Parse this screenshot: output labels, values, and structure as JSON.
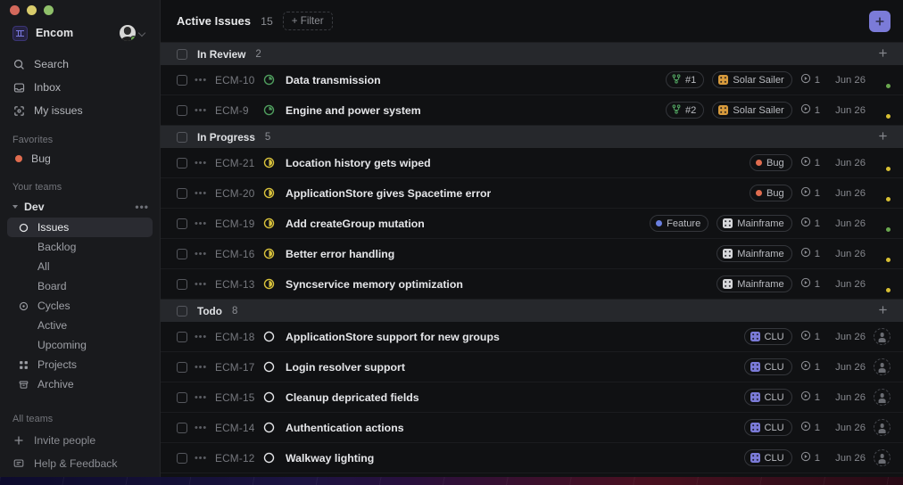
{
  "window": {
    "traffic_lights": [
      "close",
      "minimize",
      "maximize"
    ]
  },
  "sidebar": {
    "workspace": {
      "name": "Encom",
      "logo": "encom-logo",
      "chevron": "chevron-down-icon"
    },
    "nav": [
      {
        "label": "Search",
        "icon": "search-icon"
      },
      {
        "label": "Inbox",
        "icon": "inbox-icon"
      },
      {
        "label": "My issues",
        "icon": "my-issues-icon"
      }
    ],
    "favorites": {
      "label": "Favorites",
      "items": [
        {
          "label": "Bug",
          "color": "#e06c4f"
        }
      ]
    },
    "your_teams": {
      "label": "Your teams",
      "team": {
        "name": "Dev",
        "menu": "•••"
      },
      "items": [
        {
          "label": "Issues",
          "icon": "circle-icon",
          "active": true
        },
        {
          "label": "Backlog",
          "icon": ""
        },
        {
          "label": "All",
          "icon": ""
        },
        {
          "label": "Board",
          "icon": ""
        },
        {
          "label": "Cycles",
          "icon": "cycle-icon"
        },
        {
          "label": "Active",
          "icon": ""
        },
        {
          "label": "Upcoming",
          "icon": ""
        },
        {
          "label": "Projects",
          "icon": "projects-icon"
        },
        {
          "label": "Archive",
          "icon": "archive-icon"
        }
      ]
    },
    "all_teams_label": "All teams",
    "footer": [
      {
        "label": "Invite people",
        "icon": "plus-icon"
      },
      {
        "label": "Help & Feedback",
        "icon": "help-icon"
      }
    ]
  },
  "topbar": {
    "title": "Active Issues",
    "count": "15",
    "filter_label": "+ Filter",
    "new_issue_icon": "plus-icon",
    "accent_color": "#7b7bd8"
  },
  "groups": [
    {
      "name": "In Review",
      "count": "2",
      "status_icon": "in-review-icon",
      "status_color": "#4f9e5e",
      "add_icon": "plus-icon",
      "rows": [
        {
          "id": "ECM-10",
          "title": "Data transmission",
          "branch": "#1",
          "label": null,
          "label_color": null,
          "project": "Solar Sailer",
          "project_color": "#d79a3c",
          "estimate": "1",
          "date": "Jun 26",
          "assignee": "avatar-dark",
          "presence": "#6aa84f"
        },
        {
          "id": "ECM-9",
          "title": "Engine and power system",
          "branch": "#2",
          "label": null,
          "label_color": null,
          "project": "Solar Sailer",
          "project_color": "#d79a3c",
          "estimate": "1",
          "date": "Jun 26",
          "assignee": "avatar-light",
          "presence": "#d8c033"
        }
      ]
    },
    {
      "name": "In Progress",
      "count": "5",
      "status_icon": "in-progress-icon",
      "status_color": "#d9c23c",
      "add_icon": "plus-icon",
      "rows": [
        {
          "id": "ECM-21",
          "title": "Location history gets wiped",
          "branch": null,
          "label": "Bug",
          "label_color": "#e06c4f",
          "project": null,
          "project_color": null,
          "estimate": "1",
          "date": "Jun 26",
          "assignee": "avatar-light",
          "presence": "#d8c033"
        },
        {
          "id": "ECM-20",
          "title": "ApplicationStore gives Spacetime error",
          "branch": null,
          "label": "Bug",
          "label_color": "#e06c4f",
          "project": null,
          "project_color": null,
          "estimate": "1",
          "date": "Jun 26",
          "assignee": "avatar-light",
          "presence": "#d8c033"
        },
        {
          "id": "ECM-19",
          "title": "Add createGroup mutation",
          "branch": null,
          "label": "Feature",
          "label_color": "#6a7fe0",
          "project": "Mainframe",
          "project_color": "#d6d7da",
          "estimate": "1",
          "date": "Jun 26",
          "assignee": "avatar-dark",
          "presence": "#6aa84f"
        },
        {
          "id": "ECM-16",
          "title": "Better error handling",
          "branch": null,
          "label": null,
          "label_color": null,
          "project": "Mainframe",
          "project_color": "#d6d7da",
          "estimate": "1",
          "date": "Jun 26",
          "assignee": "avatar-light",
          "presence": "#d8c033"
        },
        {
          "id": "ECM-13",
          "title": "Syncservice memory optimization",
          "branch": null,
          "label": null,
          "label_color": null,
          "project": "Mainframe",
          "project_color": "#d6d7da",
          "estimate": "1",
          "date": "Jun 26",
          "assignee": "avatar-light",
          "presence": "#d8c033"
        }
      ]
    },
    {
      "name": "Todo",
      "count": "8",
      "status_icon": "todo-icon",
      "status_color": "#e3e4e7",
      "add_icon": "plus-icon",
      "rows": [
        {
          "id": "ECM-18",
          "title": "ApplicationStore support for new groups",
          "branch": null,
          "label": null,
          "label_color": null,
          "project": "CLU",
          "project_color": "#7b7bd8",
          "estimate": "1",
          "date": "Jun 26",
          "assignee": "unassigned",
          "presence": null
        },
        {
          "id": "ECM-17",
          "title": "Login resolver support",
          "branch": null,
          "label": null,
          "label_color": null,
          "project": "CLU",
          "project_color": "#7b7bd8",
          "estimate": "1",
          "date": "Jun 26",
          "assignee": "unassigned",
          "presence": null
        },
        {
          "id": "ECM-15",
          "title": "Cleanup depricated fields",
          "branch": null,
          "label": null,
          "label_color": null,
          "project": "CLU",
          "project_color": "#7b7bd8",
          "estimate": "1",
          "date": "Jun 26",
          "assignee": "unassigned",
          "presence": null
        },
        {
          "id": "ECM-14",
          "title": "Authentication actions",
          "branch": null,
          "label": null,
          "label_color": null,
          "project": "CLU",
          "project_color": "#7b7bd8",
          "estimate": "1",
          "date": "Jun 26",
          "assignee": "unassigned",
          "presence": null
        },
        {
          "id": "ECM-12",
          "title": "Walkway lighting",
          "branch": null,
          "label": null,
          "label_color": null,
          "project": "CLU",
          "project_color": "#7b7bd8",
          "estimate": "1",
          "date": "Jun 26",
          "assignee": "unassigned",
          "presence": null
        }
      ]
    }
  ]
}
